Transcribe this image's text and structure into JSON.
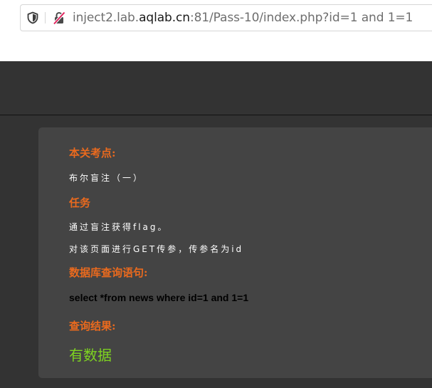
{
  "browser": {
    "url_host_prefix": "inject2.lab.",
    "url_host_main": "aqlab.cn",
    "url_rest": ":81/Pass-10/index.php?id=1 and 1=1"
  },
  "panel": {
    "test_point_heading": "本关考点:",
    "test_point_text": "布尔盲注（一）",
    "task_heading": "任务",
    "task_line1": "通过盲注获得flag。",
    "task_line2": "对该页面进行GET传参，传参名为id",
    "query_heading": "数据库查询语句:",
    "query_text": "select *from news where id=1 and 1=1",
    "result_heading": "查询结果:",
    "result_text": "有数据"
  },
  "colors": {
    "heading": "#ea6a1e",
    "result": "#7ed321",
    "panel_bg": "#444444",
    "page_bg": "#333333"
  },
  "icons": [
    "shield-icon",
    "insecure-lock-icon"
  ]
}
